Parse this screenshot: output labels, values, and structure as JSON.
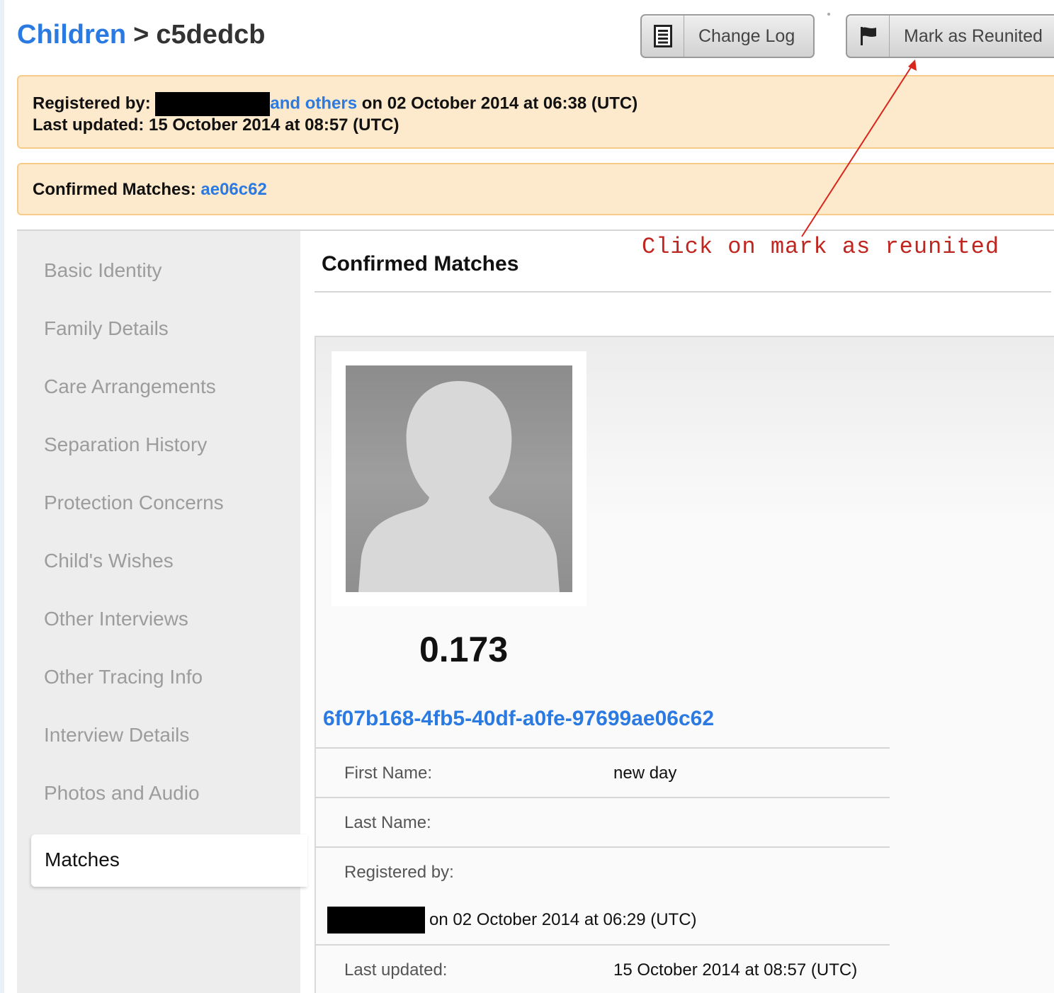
{
  "header": {
    "breadcrumb_link": "Children",
    "breadcrumb_sep": ">",
    "record_id": "c5dedcb"
  },
  "toolbar": {
    "change_log_label": "Change Log",
    "change_log_icon": "document-list-icon",
    "mark_reunited_label": "Mark as Reunited",
    "mark_reunited_icon": "flag-icon"
  },
  "registration": {
    "registered_by_label": "Registered by:",
    "registered_by_others": "and others",
    "registered_on": "on 02 October 2014 at 06:38 (UTC)",
    "last_updated_label": "Last updated:",
    "last_updated_value": "15 October 2014 at 08:57 (UTC)"
  },
  "confirmed_notice": {
    "label": "Confirmed Matches:",
    "match_link": "ae06c62"
  },
  "sidebar": {
    "items": [
      {
        "label": "Basic Identity"
      },
      {
        "label": "Family Details"
      },
      {
        "label": "Care Arrangements"
      },
      {
        "label": "Separation History"
      },
      {
        "label": "Protection Concerns"
      },
      {
        "label": "Child's Wishes"
      },
      {
        "label": "Other Interviews"
      },
      {
        "label": "Other Tracing Info"
      },
      {
        "label": "Interview Details"
      },
      {
        "label": "Photos and Audio"
      }
    ],
    "active_item": "Matches"
  },
  "main": {
    "section_title": "Confirmed Matches",
    "annotation": "Click on mark as reunited",
    "match": {
      "score": "0.173",
      "uuid": "6f07b168-4fb5-40df-a0fe-97699ae06c62",
      "first_name_label": "First Name:",
      "first_name_value": "new day",
      "last_name_label": "Last Name:",
      "last_name_value": "",
      "registered_by_label": "Registered by:",
      "registered_on": "on 02 October 2014 at 06:29 (UTC)",
      "last_updated_label": "Last updated:",
      "last_updated_value": "15 October 2014 at 08:57 (UTC)"
    }
  },
  "colors": {
    "link": "#2a7ae2",
    "notice_bg": "#fde9cb",
    "notice_border": "#f7cc8a",
    "annotation": "#c0261f",
    "sidebar_bg": "#ededed",
    "sidebar_text": "#9c9c9c"
  }
}
